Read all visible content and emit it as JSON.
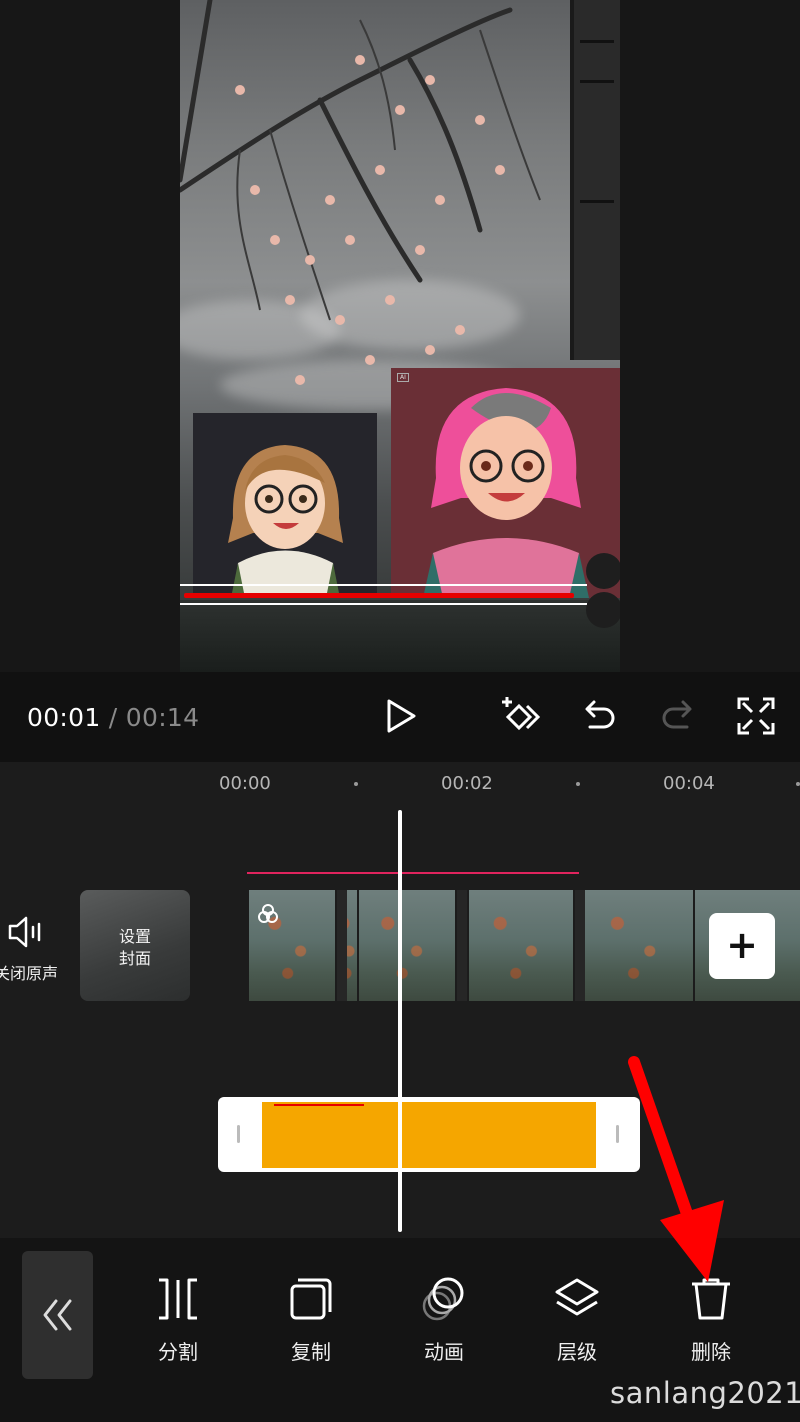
{
  "preview": {
    "ai_tag": "AI"
  },
  "player": {
    "current_time": "00:01",
    "separator": "/",
    "total_time": "00:14",
    "icons": [
      "play-icon",
      "keyframe-add-icon",
      "undo-icon",
      "redo-icon",
      "fullscreen-icon"
    ]
  },
  "timeline": {
    "ruler": [
      "00:00",
      "00:02",
      "00:04"
    ],
    "mute_label": "关闭原声",
    "cover_label_line1": "设置",
    "cover_label_line2": "封面",
    "add_label": "+"
  },
  "toolbar": {
    "tools": [
      {
        "label": "分割",
        "icon": "split-icon"
      },
      {
        "label": "复制",
        "icon": "copy-icon"
      },
      {
        "label": "动画",
        "icon": "animation-icon"
      },
      {
        "label": "层级",
        "icon": "layers-icon"
      },
      {
        "label": "删除",
        "icon": "trash-icon"
      }
    ]
  },
  "watermark": "sanlang2021",
  "colors": {
    "accent_yellow": "#f5a600",
    "audio_line": "#e0245e",
    "annotation_red": "#ff0000"
  }
}
